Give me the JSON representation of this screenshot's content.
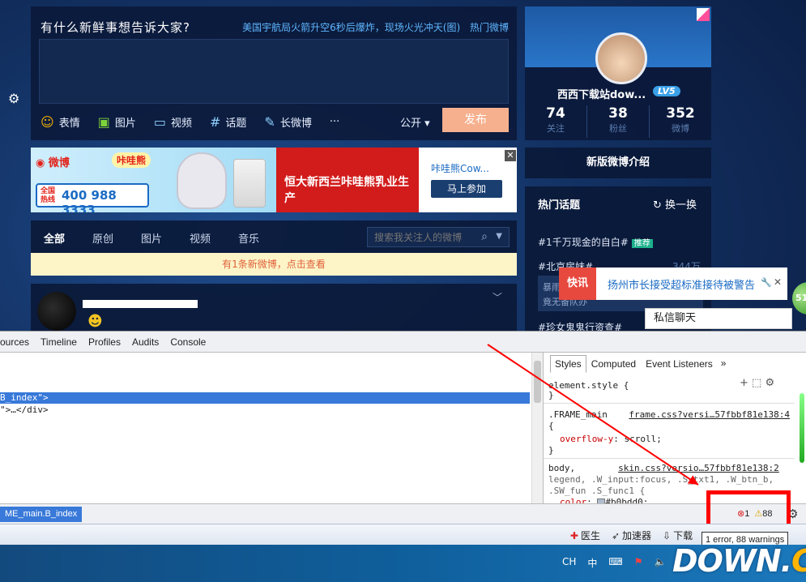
{
  "post_box": {
    "title": "有什么新鲜事想告诉大家?",
    "hot_news": "美国宇航局火箭升空6秒后爆炸，现场火光冲天(图)",
    "hot_topic_label": "热门微博",
    "tools": [
      {
        "icon": "smile-icon",
        "label": "表情"
      },
      {
        "icon": "image-icon",
        "label": "图片"
      },
      {
        "icon": "video-icon",
        "label": "视频"
      },
      {
        "icon": "hashtag-icon",
        "label": "话题"
      },
      {
        "icon": "long-post-icon",
        "label": "长微博"
      },
      {
        "icon": "more-icon",
        "label": "···"
      }
    ],
    "visibility": "公开",
    "publish_label": "发布"
  },
  "ad": {
    "weibo_label": "微博",
    "brand": "咔哇熊",
    "hotline_label": "全国热线",
    "hotline_number": "400 988 3333",
    "slogan": "恒大新西兰咔哇熊乳业生产",
    "side_title": "咔哇熊Cow...",
    "join_label": "马上参加",
    "close": "✕"
  },
  "feed_nav": {
    "tabs": [
      "全部",
      "原创",
      "图片",
      "视频",
      "音乐"
    ],
    "search_placeholder": "搜索我关注人的微博"
  },
  "new_bar": "有1条新微博，点击查看",
  "profile": {
    "name": "西西下载站dow...",
    "level": "LV5",
    "stats": [
      {
        "value": "74",
        "label": "关注"
      },
      {
        "value": "38",
        "label": "粉丝"
      },
      {
        "value": "352",
        "label": "微博"
      }
    ]
  },
  "intro_label": "新版微博介绍",
  "topics": {
    "title": "热门话题",
    "refresh": "换一换",
    "items": [
      "#1千万现金的自白#",
      "#北京房妹#"
    ],
    "recommend_tag": "推荐",
    "count": "344万",
    "card_lines": [
      "暴雨",
      "竟无备队办"
    ],
    "last": "#珍女鬼鬼行资查#"
  },
  "kuaixun": {
    "label": "快讯",
    "text": "扬州市长接受超标准接待被警告",
    "close": "✕"
  },
  "chat_label": "私信聊天",
  "side_ball": "51",
  "devtools": {
    "tabs": [
      "ources",
      "Timeline",
      "Profiles",
      "Audits",
      "Console"
    ],
    "dom_selected": "B_index\">",
    "dom_line2": "\">…</div>",
    "styles_tabs": [
      "Styles",
      "Computed",
      "Event Listeners"
    ],
    "styles_more": "»",
    "element_style": "element.style {",
    "rule1_selector": ".FRAME_main",
    "rule1_link": "frame.css?versi…57fbbf81e138:4",
    "rule1_prop": "overflow-y",
    "rule1_value": "scroll;",
    "rule2_selector": "body,",
    "rule2_link": "skin.css?versio…57fbbf81e138:2",
    "rule2_line2": "legend, .W_input:focus, .S_txt1, .W_btn_b,",
    "rule2_line3": ".SW_fun .S_func1 {",
    "rule2_prop": "color",
    "rule2_value": "#b0bdd0;",
    "open_brace": "{",
    "close_brace": "}",
    "breadcrumb": "ME_main.B_index",
    "errors": "1",
    "warnings": "88",
    "tooltip": "1 error, 88 warnings"
  },
  "browser_status": [
    {
      "icon": "plus-cross-icon",
      "label": "医生"
    },
    {
      "icon": "rocket-icon",
      "label": "加速器"
    },
    {
      "icon": "download-icon",
      "label": "下载"
    },
    {
      "icon": "flag-icon",
      "label": ""
    },
    {
      "icon": "ie-icon",
      "label": ""
    }
  ],
  "taskbar": [
    "CH",
    "中"
  ],
  "watermark": {
    "main": "DOWN",
    "dot": ".",
    "cc": "CC"
  },
  "colors": {
    "accent_red": "#ff0000",
    "weibo_bg": "#123061",
    "dev_select": "#3879d9"
  }
}
